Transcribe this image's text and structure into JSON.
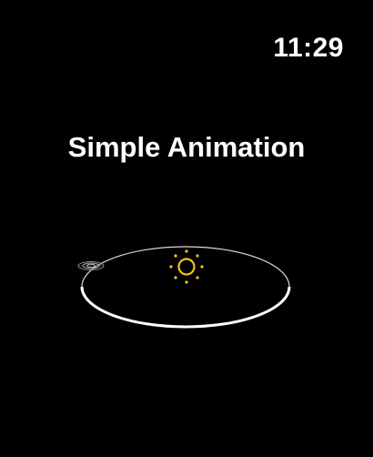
{
  "status": {
    "time": "11:29"
  },
  "screen": {
    "title": "Simple Animation"
  },
  "scene": {
    "sun_icon": "sun-icon",
    "planet_icon": "planet-icon",
    "orbit_color": "#ffffff",
    "sun_color": "#f5c518",
    "planet_color": "#9a9a9a",
    "background": "#000000"
  }
}
